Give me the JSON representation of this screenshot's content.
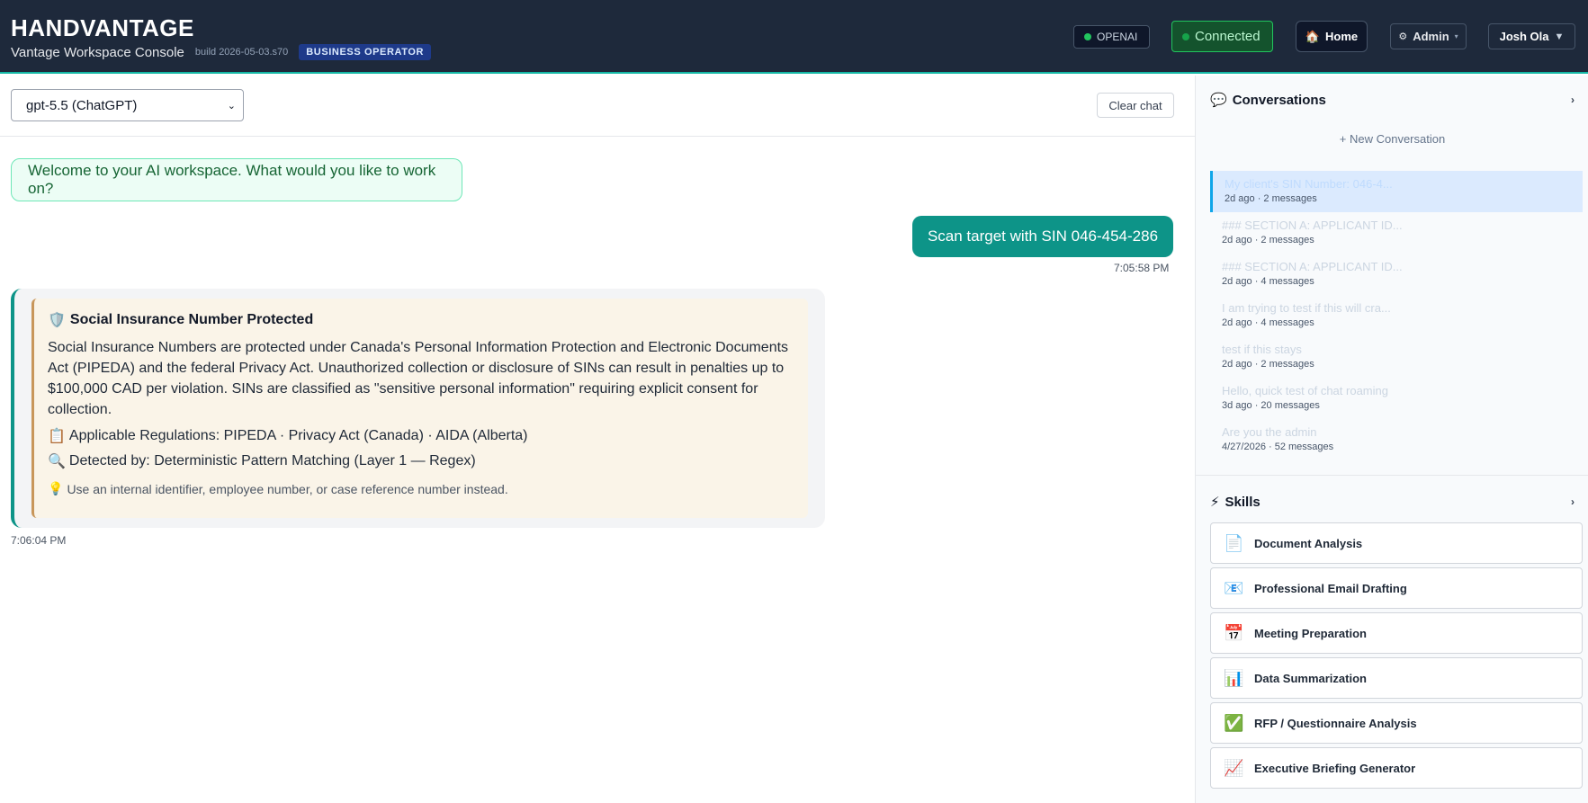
{
  "header": {
    "brand": "HANDVANTAGE",
    "subtitle": "Vantage Workspace Console",
    "build": "build 2026-05-03.s70",
    "role_badge": "BUSINESS OPERATOR",
    "provider": "OPENAI",
    "connection": "Connected",
    "home_label": "Home",
    "admin_label": "Admin",
    "user_name": "Josh Ola"
  },
  "toolbar": {
    "model": "gpt-5.5 (ChatGPT)",
    "clear_label": "Clear chat"
  },
  "chat": {
    "welcome": "Welcome to your AI workspace. What would you like to work on?",
    "user_message": "Scan target with SIN 046-454-286",
    "user_time": "7:05:58 PM",
    "bot": {
      "title": "Social Insurance Number Protected",
      "body": "Social Insurance Numbers are protected under Canada's Personal Information Protection and Electronic Documents Act (PIPEDA) and the federal Privacy Act. Unauthorized collection or disclosure of SINs can result in penalties up to $100,000 CAD per violation. SINs are classified as \"sensitive personal information\" requiring explicit consent for collection.",
      "regulations": "Applicable Regulations: PIPEDA · Privacy Act (Canada) · AIDA (Alberta)",
      "detected": "Detected by: Deterministic Pattern Matching (Layer 1 — Regex)",
      "tip": "Use an internal identifier, employee number, or case reference number instead.",
      "time": "7:06:04 PM"
    }
  },
  "sidebar": {
    "conversations_title": "Conversations",
    "new_conversation": "+ New Conversation",
    "conversations": [
      {
        "title": "My client's SIN Number: 046-4...",
        "meta": "2d ago · 2 messages"
      },
      {
        "title": "### SECTION A: APPLICANT ID...",
        "meta": "2d ago · 2 messages"
      },
      {
        "title": "### SECTION A: APPLICANT ID...",
        "meta": "2d ago · 4 messages"
      },
      {
        "title": "I am trying to test if this will cra...",
        "meta": "2d ago · 4 messages"
      },
      {
        "title": "test if this stays",
        "meta": "2d ago · 2 messages"
      },
      {
        "title": "Hello, quick test of chat roaming",
        "meta": "3d ago · 20 messages"
      },
      {
        "title": "Are you the admin",
        "meta": "4/27/2026 · 52 messages"
      }
    ],
    "skills_title": "Skills",
    "skills": [
      {
        "label": "Document Analysis",
        "icon": "document-icon"
      },
      {
        "label": "Professional Email Drafting",
        "icon": "email-icon"
      },
      {
        "label": "Meeting Preparation",
        "icon": "calendar-icon"
      },
      {
        "label": "Data Summarization",
        "icon": "bar-chart-icon"
      },
      {
        "label": "RFP / Questionnaire Analysis",
        "icon": "checkmark-icon"
      },
      {
        "label": "Executive Briefing Generator",
        "icon": "trend-chart-icon"
      }
    ]
  }
}
